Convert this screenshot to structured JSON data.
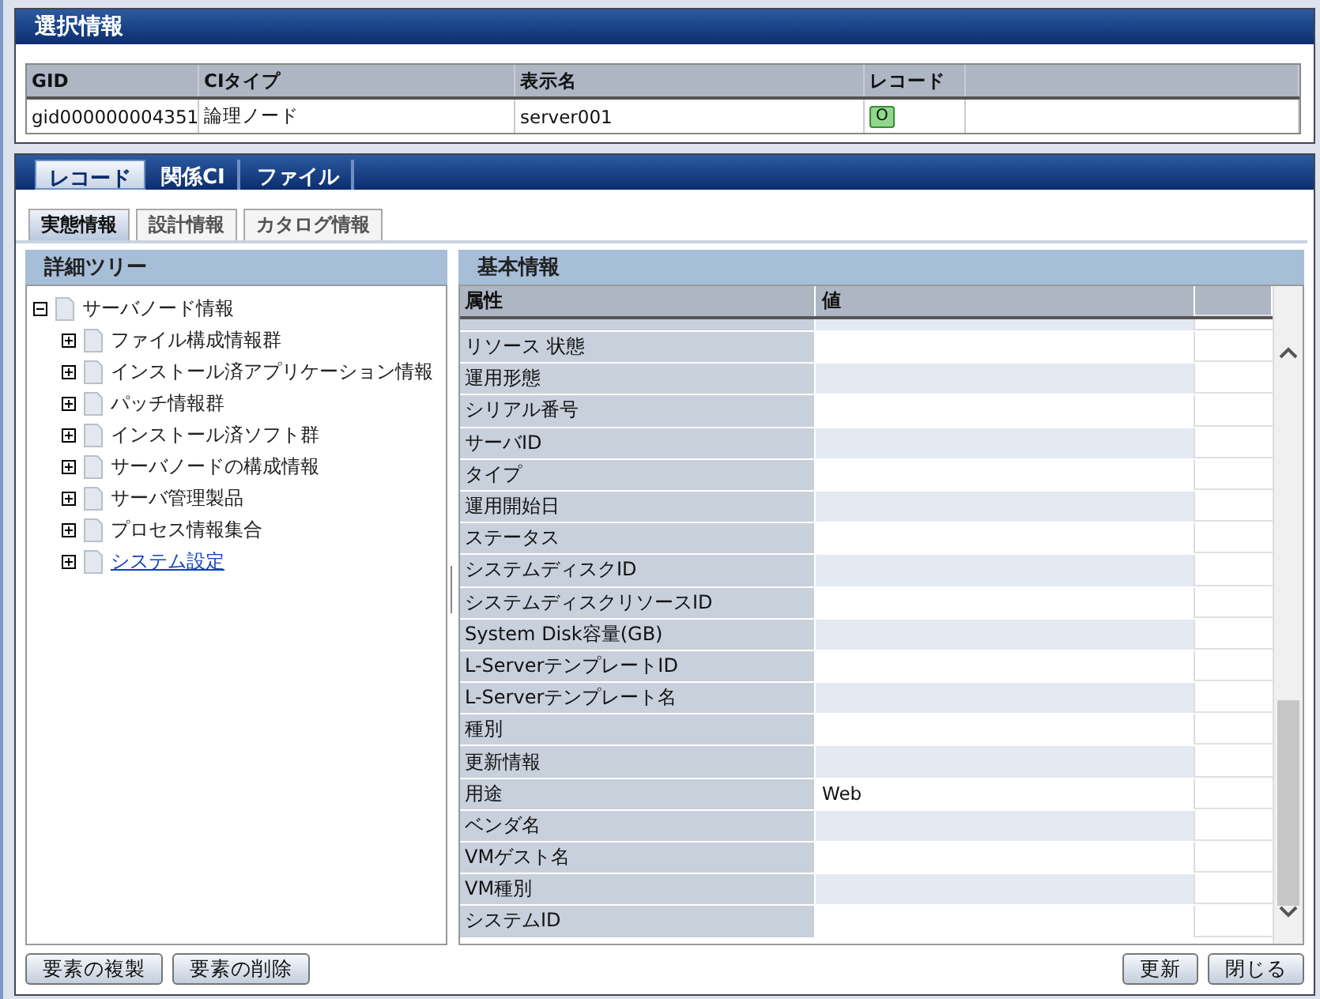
{
  "selection_panel": {
    "title": "選択情報",
    "columns": [
      "GID",
      "CIタイプ",
      "表示名",
      "レコード"
    ],
    "rows": [
      {
        "gid": "gid000000004351",
        "ci_type": "論理ノード",
        "display_name": "server001",
        "record": "O"
      }
    ]
  },
  "tabs": [
    {
      "label": "レコード",
      "selected": true
    },
    {
      "label": "関係CI",
      "selected": false
    },
    {
      "label": "ファイル",
      "selected": false
    }
  ],
  "sub_tabs": [
    {
      "label": "実態情報",
      "selected": true
    },
    {
      "label": "設計情報",
      "selected": false
    },
    {
      "label": "カタログ情報",
      "selected": false
    }
  ],
  "detail_tree": {
    "title": "詳細ツリー",
    "nodes": [
      {
        "label": "サーバノード情報",
        "expanded": true,
        "link": false,
        "children": [
          {
            "label": "ファイル構成情報群",
            "expanded": false,
            "link": false
          },
          {
            "label": "インストール済アプリケーション情報",
            "expanded": false,
            "link": false
          },
          {
            "label": "パッチ情報群",
            "expanded": false,
            "link": false
          },
          {
            "label": "インストール済ソフト群",
            "expanded": false,
            "link": false
          },
          {
            "label": "サーバノードの構成情報",
            "expanded": false,
            "link": false
          },
          {
            "label": "サーバ管理製品",
            "expanded": false,
            "link": false
          },
          {
            "label": "プロセス情報集合",
            "expanded": false,
            "link": false
          },
          {
            "label": "システム設定",
            "expanded": false,
            "link": true
          }
        ]
      }
    ]
  },
  "basic_info": {
    "title": "基本情報",
    "columns": [
      "属性",
      "値"
    ],
    "rows": [
      {
        "attribute": "リソース 状態"
      },
      {
        "attribute": "運用形態"
      },
      {
        "attribute": "シリアル番号"
      },
      {
        "attribute": "サーバID"
      },
      {
        "attribute": "タイプ"
      },
      {
        "attribute": "運用開始日"
      },
      {
        "attribute": "ステータス"
      },
      {
        "attribute": "システムディスクID"
      },
      {
        "attribute": "システムディスクリソースID"
      },
      {
        "attribute": "System Disk容量(GB)"
      },
      {
        "attribute": "L-ServerテンプレートID"
      },
      {
        "attribute": "L-Serverテンプレート名"
      },
      {
        "attribute": "種別"
      },
      {
        "attribute": "更新情報"
      },
      {
        "attribute": "用途",
        "value": "Web"
      },
      {
        "attribute": "ベンダ名"
      },
      {
        "attribute": "VMゲスト名"
      },
      {
        "attribute": "VM種別"
      },
      {
        "attribute": "システムID"
      }
    ]
  },
  "left_buttons": [
    "要素の複製",
    "要素の削除"
  ],
  "right_buttons": [
    "更新",
    "閉じる"
  ]
}
